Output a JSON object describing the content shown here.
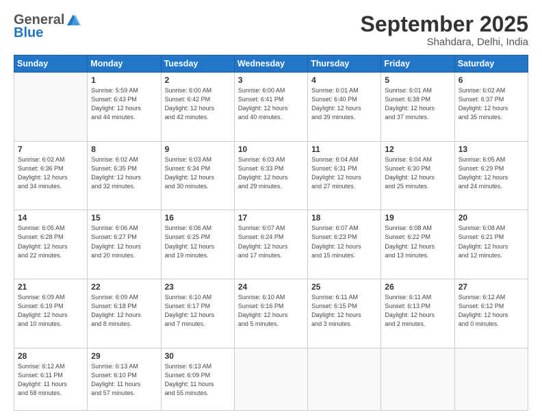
{
  "logo": {
    "general": "General",
    "blue": "Blue"
  },
  "header": {
    "month": "September 2025",
    "location": "Shahdara, Delhi, India"
  },
  "weekdays": [
    "Sunday",
    "Monday",
    "Tuesday",
    "Wednesday",
    "Thursday",
    "Friday",
    "Saturday"
  ],
  "weeks": [
    [
      {
        "day": "",
        "info": ""
      },
      {
        "day": "1",
        "info": "Sunrise: 5:59 AM\nSunset: 6:43 PM\nDaylight: 12 hours\nand 44 minutes."
      },
      {
        "day": "2",
        "info": "Sunrise: 6:00 AM\nSunset: 6:42 PM\nDaylight: 12 hours\nand 42 minutes."
      },
      {
        "day": "3",
        "info": "Sunrise: 6:00 AM\nSunset: 6:41 PM\nDaylight: 12 hours\nand 40 minutes."
      },
      {
        "day": "4",
        "info": "Sunrise: 6:01 AM\nSunset: 6:40 PM\nDaylight: 12 hours\nand 39 minutes."
      },
      {
        "day": "5",
        "info": "Sunrise: 6:01 AM\nSunset: 6:38 PM\nDaylight: 12 hours\nand 37 minutes."
      },
      {
        "day": "6",
        "info": "Sunrise: 6:02 AM\nSunset: 6:37 PM\nDaylight: 12 hours\nand 35 minutes."
      }
    ],
    [
      {
        "day": "7",
        "info": "Sunrise: 6:02 AM\nSunset: 6:36 PM\nDaylight: 12 hours\nand 34 minutes."
      },
      {
        "day": "8",
        "info": "Sunrise: 6:02 AM\nSunset: 6:35 PM\nDaylight: 12 hours\nand 32 minutes."
      },
      {
        "day": "9",
        "info": "Sunrise: 6:03 AM\nSunset: 6:34 PM\nDaylight: 12 hours\nand 30 minutes."
      },
      {
        "day": "10",
        "info": "Sunrise: 6:03 AM\nSunset: 6:33 PM\nDaylight: 12 hours\nand 29 minutes."
      },
      {
        "day": "11",
        "info": "Sunrise: 6:04 AM\nSunset: 6:31 PM\nDaylight: 12 hours\nand 27 minutes."
      },
      {
        "day": "12",
        "info": "Sunrise: 6:04 AM\nSunset: 6:30 PM\nDaylight: 12 hours\nand 25 minutes."
      },
      {
        "day": "13",
        "info": "Sunrise: 6:05 AM\nSunset: 6:29 PM\nDaylight: 12 hours\nand 24 minutes."
      }
    ],
    [
      {
        "day": "14",
        "info": "Sunrise: 6:05 AM\nSunset: 6:28 PM\nDaylight: 12 hours\nand 22 minutes."
      },
      {
        "day": "15",
        "info": "Sunrise: 6:06 AM\nSunset: 6:27 PM\nDaylight: 12 hours\nand 20 minutes."
      },
      {
        "day": "16",
        "info": "Sunrise: 6:06 AM\nSunset: 6:25 PM\nDaylight: 12 hours\nand 19 minutes."
      },
      {
        "day": "17",
        "info": "Sunrise: 6:07 AM\nSunset: 6:24 PM\nDaylight: 12 hours\nand 17 minutes."
      },
      {
        "day": "18",
        "info": "Sunrise: 6:07 AM\nSunset: 6:23 PM\nDaylight: 12 hours\nand 15 minutes."
      },
      {
        "day": "19",
        "info": "Sunrise: 6:08 AM\nSunset: 6:22 PM\nDaylight: 12 hours\nand 13 minutes."
      },
      {
        "day": "20",
        "info": "Sunrise: 6:08 AM\nSunset: 6:21 PM\nDaylight: 12 hours\nand 12 minutes."
      }
    ],
    [
      {
        "day": "21",
        "info": "Sunrise: 6:09 AM\nSunset: 6:19 PM\nDaylight: 12 hours\nand 10 minutes."
      },
      {
        "day": "22",
        "info": "Sunrise: 6:09 AM\nSunset: 6:18 PM\nDaylight: 12 hours\nand 8 minutes."
      },
      {
        "day": "23",
        "info": "Sunrise: 6:10 AM\nSunset: 6:17 PM\nDaylight: 12 hours\nand 7 minutes."
      },
      {
        "day": "24",
        "info": "Sunrise: 6:10 AM\nSunset: 6:16 PM\nDaylight: 12 hours\nand 5 minutes."
      },
      {
        "day": "25",
        "info": "Sunrise: 6:11 AM\nSunset: 6:15 PM\nDaylight: 12 hours\nand 3 minutes."
      },
      {
        "day": "26",
        "info": "Sunrise: 6:11 AM\nSunset: 6:13 PM\nDaylight: 12 hours\nand 2 minutes."
      },
      {
        "day": "27",
        "info": "Sunrise: 6:12 AM\nSunset: 6:12 PM\nDaylight: 12 hours\nand 0 minutes."
      }
    ],
    [
      {
        "day": "28",
        "info": "Sunrise: 6:12 AM\nSunset: 6:11 PM\nDaylight: 11 hours\nand 58 minutes."
      },
      {
        "day": "29",
        "info": "Sunrise: 6:13 AM\nSunset: 6:10 PM\nDaylight: 11 hours\nand 57 minutes."
      },
      {
        "day": "30",
        "info": "Sunrise: 6:13 AM\nSunset: 6:09 PM\nDaylight: 11 hours\nand 55 minutes."
      },
      {
        "day": "",
        "info": ""
      },
      {
        "day": "",
        "info": ""
      },
      {
        "day": "",
        "info": ""
      },
      {
        "day": "",
        "info": ""
      }
    ]
  ]
}
